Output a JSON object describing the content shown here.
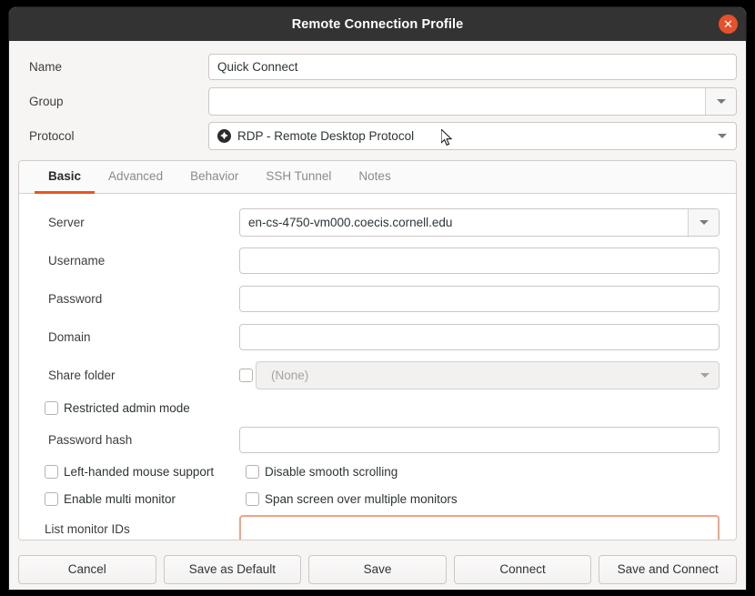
{
  "window": {
    "title": "Remote Connection Profile",
    "close_label": "✕",
    "close_icon": "close-icon",
    "accent_color": "#e95420",
    "titlebar_color": "#333333",
    "background_color": "#f6f5f4"
  },
  "top_fields": {
    "name": {
      "label": "Name",
      "value": "Quick Connect"
    },
    "group": {
      "label": "Group",
      "value": "",
      "dropdown_icon": "chevron-down-icon"
    },
    "protocol": {
      "label": "Protocol",
      "value": "RDP - Remote Desktop Protocol",
      "icon": "rdp-protocol-icon",
      "dropdown_icon": "chevron-down-icon"
    }
  },
  "tabs": [
    {
      "label": "Basic",
      "active": true
    },
    {
      "label": "Advanced",
      "active": false
    },
    {
      "label": "Behavior",
      "active": false
    },
    {
      "label": "SSH Tunnel",
      "active": false
    },
    {
      "label": "Notes",
      "active": false
    }
  ],
  "basic": {
    "server": {
      "label": "Server",
      "value": "en-cs-4750-vm000.coecis.cornell.edu",
      "dropdown_icon": "chevron-down-icon"
    },
    "username": {
      "label": "Username",
      "value": ""
    },
    "password": {
      "label": "Password",
      "value": ""
    },
    "domain": {
      "label": "Domain",
      "value": ""
    },
    "share_folder": {
      "label": "Share folder",
      "value": "(None)",
      "enabled": false,
      "checked": false,
      "dropdown_icon": "chevron-down-icon"
    },
    "restricted_admin": {
      "label": "Restricted admin mode",
      "checked": false
    },
    "password_hash": {
      "label": "Password hash",
      "value": ""
    },
    "left_handed": {
      "label": "Left-handed mouse support",
      "checked": false
    },
    "disable_smooth_scrolling": {
      "label": "Disable smooth scrolling",
      "checked": false
    },
    "enable_multi_monitor": {
      "label": "Enable multi monitor",
      "checked": false
    },
    "span_screen": {
      "label": "Span screen over multiple monitors",
      "checked": false
    },
    "list_monitor_ids": {
      "label": "List monitor IDs",
      "value": "",
      "focused": true
    }
  },
  "buttons": [
    {
      "label": "Cancel"
    },
    {
      "label": "Save as Default"
    },
    {
      "label": "Save"
    },
    {
      "label": "Connect"
    },
    {
      "label": "Save and Connect"
    }
  ]
}
